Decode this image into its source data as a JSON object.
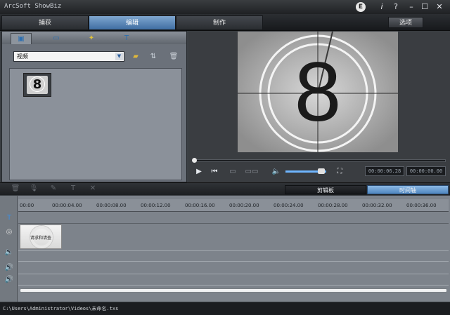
{
  "app": {
    "title": "ArcSoft ShowBiz"
  },
  "window_controls": {
    "e": "E",
    "info": "i",
    "help": "?",
    "minimize": "–",
    "maximize": "☐",
    "close": "✕"
  },
  "nav": {
    "tabs": [
      {
        "label": "捕获",
        "active": false
      },
      {
        "label": "编辑",
        "active": true
      },
      {
        "label": "制作",
        "active": false
      }
    ],
    "options_label": "选项"
  },
  "left_panel": {
    "tabs": [
      "media-tab-icon",
      "filmstrip-tab-icon",
      "magic-tab-icon",
      "text-tab-icon"
    ],
    "dropdown_value": "视频",
    "thumbnail_number": "8"
  },
  "preview": {
    "countdown_number": "8",
    "playhead_fraction": 0.0,
    "volume_fraction": 0.9,
    "current_time": "00:00:06.28",
    "total_time": "00:00:00.00"
  },
  "view_tabs": {
    "storyboard": "剪辑板",
    "timeline": "时间轴"
  },
  "timeline": {
    "ruler_labels": [
      "00:00",
      "00:00:04.00",
      "00:00:08.00",
      "00:00:12.00",
      "00:00:16.00",
      "00:00:20.00",
      "00:00:24.00",
      "00:00:28.00",
      "00:00:32.00",
      "00:00:36.00"
    ],
    "clip_label": "请求和请查"
  },
  "status": {
    "path": "C:\\Users\\Administrator\\Videos\\未命名.txs"
  }
}
